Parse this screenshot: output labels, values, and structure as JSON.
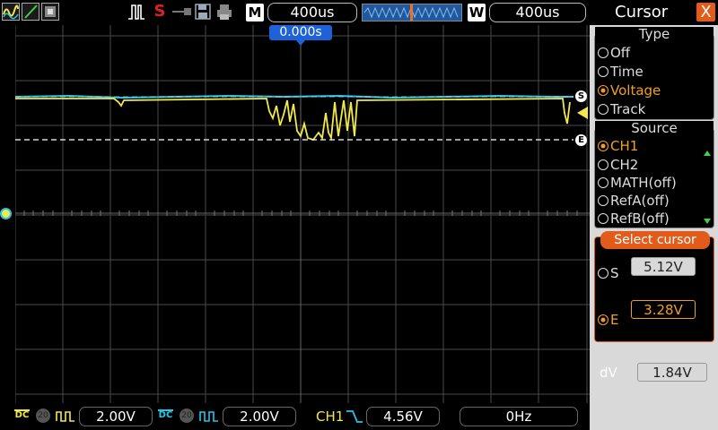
{
  "topbar": {
    "trigger_mode": "M",
    "trigger_mode_value": "400us",
    "window_mode": "W",
    "window_value": "400us",
    "icons": [
      "waveform-display-icon",
      "cursor-tool-icon",
      "screenshot-icon",
      "pulse-icon",
      "stop-icon",
      "usb-key-icon",
      "save-icon",
      "print-icon"
    ]
  },
  "screen": {
    "trigger_time": "0.000s",
    "s_marker": "S",
    "e_marker": "E"
  },
  "panel": {
    "title": "Cursor",
    "close": "X",
    "type_group": {
      "title": "Type",
      "options": [
        "Off",
        "Time",
        "Voltage",
        "Track"
      ],
      "selected": "Voltage"
    },
    "source_group": {
      "title": "Source",
      "options": [
        "CH1",
        "CH2",
        "MATH(off)",
        "RefA(off)",
        "RefB(off)"
      ],
      "selected": "CH1"
    },
    "select_group": {
      "title": "Select cursor",
      "s_label": "S",
      "s_value": "5.12V",
      "e_label": "E",
      "e_value": "3.28V",
      "selected": "E"
    },
    "dv_label": "dV",
    "dv_value": "1.84V"
  },
  "bottombar": {
    "ch1_coupling": "DC",
    "ch1_bw": "20",
    "ch1_scale": "2.00V",
    "ch2_coupling": "DC",
    "ch2_bw": "20",
    "ch2_scale": "2.00V",
    "trigger_source": "CH1",
    "trigger_level": "4.56V",
    "frequency": "0Hz"
  },
  "colors": {
    "ch1": "#f2e84a",
    "ch2": "#26c6e8",
    "accent": "#f0a020",
    "grid": "#555555"
  }
}
